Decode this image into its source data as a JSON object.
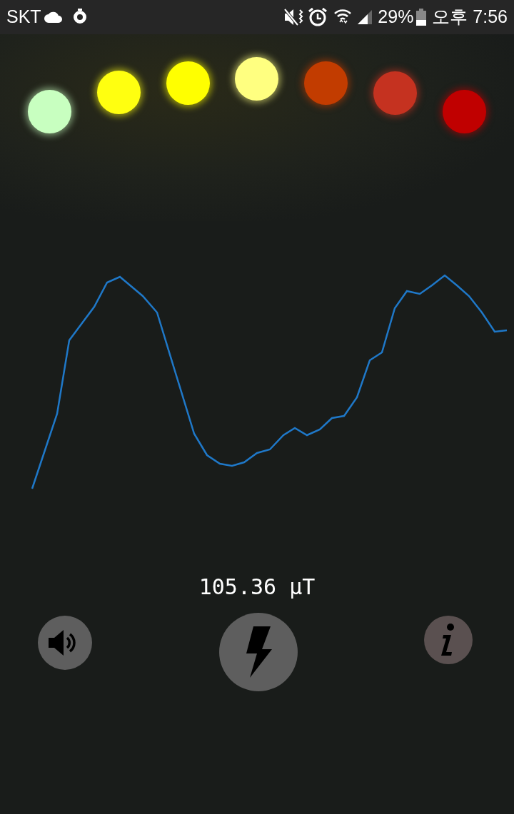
{
  "status_bar": {
    "carrier": "SKT",
    "battery": "29%",
    "time": "오후 7:56"
  },
  "lights": [
    {
      "color": "#c8ffc0",
      "on": true
    },
    {
      "color": "#ffff10",
      "on": true
    },
    {
      "color": "#ffff00",
      "on": true
    },
    {
      "color": "#ffff80",
      "on": true
    },
    {
      "color": "#c23c00",
      "on": true
    },
    {
      "color": "#c53220",
      "on": true
    },
    {
      "color": "#c00000",
      "on": true
    }
  ],
  "reading": "105.36 μT"
}
